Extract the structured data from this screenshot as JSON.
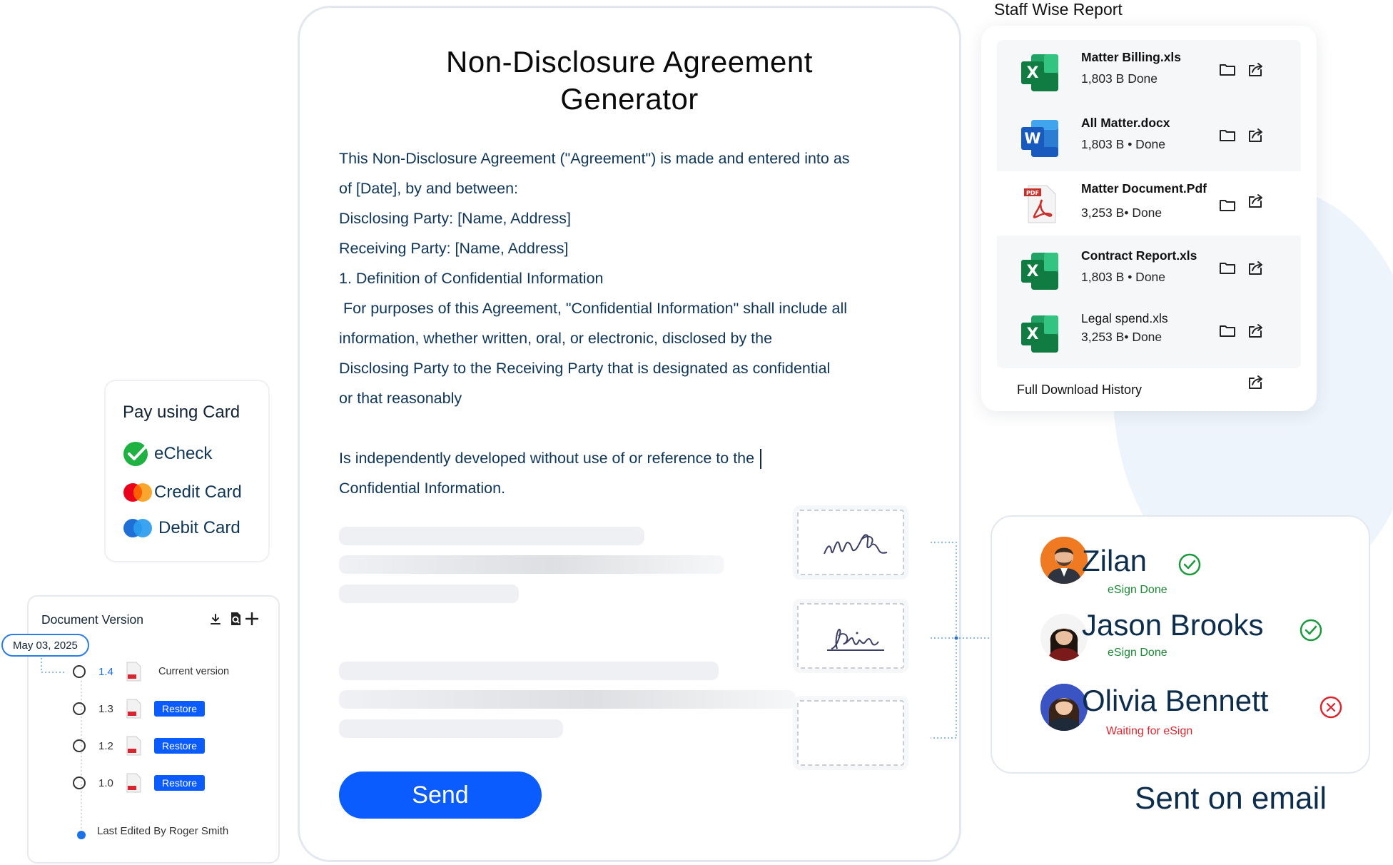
{
  "agreement": {
    "title_line1": "Non-Disclosure Agreement",
    "title_line2": "Generator",
    "lines": [
      "This Non-Disclosure Agreement (\"Agreement\") is made and entered into as",
      "of [Date], by and between:",
      "Disclosing Party: [Name, Address]",
      "Receiving Party: [Name, Address]",
      "1. Definition of Confidential Information",
      " For purposes of this Agreement, \"Confidential Information\" shall include all",
      "information, whether written, oral, or electronic, disclosed by the",
      "Disclosing Party to the Receiving Party that is designated as confidential",
      "or that reasonably"
    ],
    "lines2": [
      "Is independently developed without use of or reference to the",
      "Confidential Information."
    ],
    "send_label": "Send"
  },
  "staff_report": {
    "title": "Staff Wise Report",
    "files": [
      {
        "name": "Matter Billing.xls",
        "meta": "1,803 B  Done",
        "type": "excel"
      },
      {
        "name": "All Matter.docx",
        "meta": "1,803 B • Done",
        "type": "word"
      },
      {
        "name": "Matter Document.Pdf",
        "meta": "3,253 B• Done",
        "type": "pdf"
      },
      {
        "name": "Contract Report.xls",
        "meta": "1,803 B • Done",
        "type": "excel"
      },
      {
        "name": "Legal spend.xls",
        "meta": "3,253 B• Done",
        "type": "excel"
      }
    ],
    "history_label": "Full Download History"
  },
  "payment": {
    "title": "Pay using Card",
    "options": [
      "eCheck",
      "Credit Card",
      "Debit Card"
    ]
  },
  "doc_version": {
    "title": "Document Version",
    "date": "May 03, 2025",
    "versions": [
      {
        "num": "1.4",
        "label": "Current version"
      },
      {
        "num": "1.3",
        "label": "Restore"
      },
      {
        "num": "1.2",
        "label": "Restore"
      },
      {
        "num": "1.0",
        "label": "Restore"
      }
    ],
    "last_edited": "Last Edited By Roger Smith"
  },
  "esign": {
    "signers": [
      {
        "name": "Zilan",
        "status": "eSign Done",
        "done": true
      },
      {
        "name": "Jason Brooks",
        "status": "eSign Done",
        "done": true
      },
      {
        "name": "Olivia Bennett",
        "status": "Waiting for eSign",
        "done": false
      }
    ],
    "sent_label": "Sent on email"
  },
  "colors": {
    "primary": "#0a5cff",
    "text": "#0f3557",
    "success": "#1a9a3c",
    "danger": "#d9262e"
  }
}
